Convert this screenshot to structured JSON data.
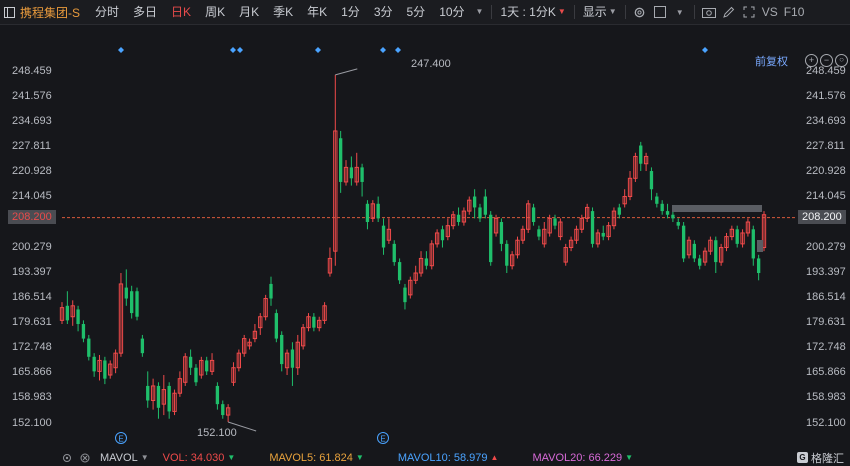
{
  "toolbar": {
    "title": "携程集团-S",
    "periods": [
      "分时",
      "多日",
      "日K",
      "周K",
      "月K",
      "季K",
      "年K",
      "1分",
      "3分",
      "5分",
      "10分"
    ],
    "active_period": "日K",
    "range_select": "1天 : 1分K",
    "display_label": "显示",
    "vs_label": "VS",
    "f10_label": "F10"
  },
  "chart": {
    "adjust_label": "前复权",
    "price_axis": [
      "248.459",
      "241.576",
      "234.693",
      "227.811",
      "220.928",
      "214.045",
      "208.200",
      "200.279",
      "193.397",
      "186.514",
      "179.631",
      "172.748",
      "165.866",
      "158.983",
      "152.100"
    ],
    "current_price": "208.200",
    "high_annotation": "247.400",
    "low_annotation": "152.100",
    "event_marker": "E",
    "colors": {
      "up": "#f04a4a",
      "down": "#1fbf6b",
      "background": "#16171b",
      "price_line": "#d85a3a",
      "diamond": "#4aa3ff"
    }
  },
  "chart_data": {
    "type": "candlestick",
    "ylim": [
      148.5,
      251.5
    ],
    "y_ticks": [
      248.459,
      241.576,
      234.693,
      227.811,
      220.928,
      214.045,
      208.2,
      200.279,
      193.397,
      186.514,
      179.631,
      172.748,
      165.866,
      158.983,
      152.1
    ],
    "candles": [
      [
        180.0,
        183.5,
        179.0,
        185.0
      ],
      [
        184.0,
        180.0,
        179.0,
        188.0
      ],
      [
        181.0,
        184.0,
        178.5,
        185.5
      ],
      [
        183.0,
        179.0,
        177.0,
        184.0
      ],
      [
        179.0,
        175.0,
        174.0,
        180.0
      ],
      [
        175.0,
        170.0,
        169.0,
        176.0
      ],
      [
        170.0,
        166.0,
        164.5,
        171.0
      ],
      [
        166.0,
        169.0,
        163.5,
        170.5
      ],
      [
        169.0,
        164.0,
        162.5,
        170.0
      ],
      [
        165.0,
        168.0,
        164.0,
        169.0
      ],
      [
        167.0,
        171.0,
        165.5,
        172.0
      ],
      [
        171.0,
        190.0,
        170.0,
        193.0
      ],
      [
        189.0,
        186.0,
        184.0,
        194.0
      ],
      [
        188.0,
        182.0,
        180.5,
        189.5
      ],
      [
        188.0,
        181.0,
        180.0,
        189.0
      ],
      [
        175.0,
        171.0,
        170.0,
        176.0
      ],
      [
        162.0,
        158.0,
        156.0,
        166.0
      ],
      [
        158.0,
        162.0,
        155.5,
        164.0
      ],
      [
        162.0,
        156.0,
        153.0,
        163.0
      ],
      [
        157.0,
        161.0,
        154.0,
        165.0
      ],
      [
        162.0,
        155.0,
        153.0,
        163.0
      ],
      [
        155.0,
        160.0,
        154.0,
        161.0
      ],
      [
        160.0,
        164.0,
        159.0,
        166.0
      ],
      [
        163.0,
        170.0,
        162.0,
        171.0
      ],
      [
        170.0,
        167.0,
        165.0,
        172.0
      ],
      [
        167.0,
        163.0,
        162.0,
        168.0
      ],
      [
        165.0,
        169.0,
        164.0,
        170.0
      ],
      [
        169.0,
        166.0,
        165.0,
        170.0
      ],
      [
        166.0,
        169.0,
        165.0,
        171.0
      ],
      [
        162.0,
        157.0,
        155.5,
        163.0
      ],
      [
        157.0,
        154.0,
        153.0,
        158.0
      ],
      [
        154.0,
        156.0,
        152.1,
        157.0
      ],
      [
        163.0,
        167.0,
        162.0,
        168.5
      ],
      [
        167.0,
        171.0,
        166.0,
        172.0
      ],
      [
        171.0,
        175.0,
        170.0,
        176.0
      ],
      [
        173.0,
        174.0,
        172.0,
        175.0
      ],
      [
        175.0,
        177.0,
        174.0,
        179.0
      ],
      [
        178.0,
        181.0,
        176.0,
        182.0
      ],
      [
        181.0,
        186.0,
        180.0,
        187.0
      ],
      [
        190.0,
        186.0,
        184.0,
        192.0
      ],
      [
        182.0,
        175.0,
        174.0,
        183.0
      ],
      [
        176.0,
        168.0,
        166.0,
        177.0
      ],
      [
        167.0,
        171.0,
        165.0,
        172.0
      ],
      [
        172.0,
        167.0,
        162.0,
        174.0
      ],
      [
        167.0,
        174.0,
        165.0,
        176.0
      ],
      [
        173.0,
        178.0,
        172.0,
        179.0
      ],
      [
        178.0,
        181.0,
        177.0,
        182.0
      ],
      [
        181.0,
        178.0,
        177.0,
        182.0
      ],
      [
        178.0,
        180.0,
        177.0,
        181.0
      ],
      [
        180.0,
        184.0,
        179.0,
        185.0
      ],
      [
        193.0,
        197.0,
        192.0,
        200.0
      ],
      [
        199.0,
        232.0,
        195.0,
        247.4
      ],
      [
        230.0,
        218.0,
        215.0,
        232.0
      ],
      [
        218.0,
        222.0,
        217.0,
        224.0
      ],
      [
        222.0,
        219.0,
        217.0,
        225.0
      ],
      [
        218.0,
        222.0,
        217.0,
        226.0
      ],
      [
        222.0,
        218.0,
        214.0,
        223.0
      ],
      [
        212.0,
        207.0,
        205.0,
        213.0
      ],
      [
        208.0,
        212.0,
        207.0,
        213.0
      ],
      [
        212.0,
        208.0,
        207.0,
        214.0
      ],
      [
        206.0,
        200.0,
        198.0,
        208.0
      ],
      [
        202.0,
        205.0,
        201.0,
        208.0
      ],
      [
        201.0,
        196.0,
        195.0,
        202.0
      ],
      [
        196.0,
        191.0,
        190.0,
        197.0
      ],
      [
        189.0,
        185.0,
        183.0,
        190.0
      ],
      [
        187.0,
        191.0,
        186.0,
        192.0
      ],
      [
        191.0,
        193.0,
        190.0,
        195.0
      ],
      [
        193.0,
        197.0,
        192.0,
        199.0
      ],
      [
        197.0,
        195.0,
        194.0,
        199.0
      ],
      [
        195.0,
        201.0,
        194.0,
        202.0
      ],
      [
        201.0,
        204.0,
        200.0,
        205.0
      ],
      [
        205.0,
        202.0,
        200.0,
        206.0
      ],
      [
        203.0,
        206.0,
        202.0,
        208.0
      ],
      [
        206.0,
        209.0,
        205.0,
        210.0
      ],
      [
        209.0,
        207.0,
        206.0,
        211.0
      ],
      [
        207.0,
        210.0,
        206.0,
        211.0
      ],
      [
        210.0,
        213.0,
        209.0,
        214.0
      ],
      [
        214.0,
        211.0,
        208.0,
        216.0
      ],
      [
        211.0,
        208.0,
        207.0,
        212.0
      ],
      [
        214.0,
        209.0,
        208.0,
        216.0
      ],
      [
        209.0,
        196.0,
        195.0,
        210.0
      ],
      [
        204.0,
        208.0,
        203.0,
        209.0
      ],
      [
        207.0,
        201.0,
        199.0,
        208.0
      ],
      [
        201.0,
        195.0,
        193.0,
        202.0
      ],
      [
        195.0,
        198.0,
        194.0,
        199.0
      ],
      [
        198.0,
        202.0,
        197.0,
        203.0
      ],
      [
        202.0,
        205.0,
        201.0,
        206.0
      ],
      [
        205.0,
        212.0,
        204.0,
        213.0
      ],
      [
        211.0,
        207.0,
        206.0,
        212.0
      ],
      [
        205.0,
        203.0,
        202.0,
        206.0
      ],
      [
        201.0,
        205.0,
        200.0,
        207.0
      ],
      [
        204.0,
        208.0,
        203.0,
        209.0
      ],
      [
        208.0,
        206.0,
        205.0,
        209.0
      ],
      [
        203.0,
        207.0,
        202.0,
        208.0
      ],
      [
        196.0,
        200.0,
        195.0,
        201.0
      ],
      [
        200.0,
        202.0,
        199.0,
        203.0
      ],
      [
        202.0,
        205.0,
        201.0,
        206.0
      ],
      [
        205.0,
        208.0,
        204.0,
        209.0
      ],
      [
        208.0,
        211.0,
        207.0,
        212.0
      ],
      [
        210.0,
        201.0,
        200.0,
        211.0
      ],
      [
        201.0,
        204.0,
        200.0,
        205.0
      ],
      [
        204.0,
        203.0,
        202.0,
        206.0
      ],
      [
        203.0,
        206.0,
        202.0,
        207.0
      ],
      [
        206.0,
        210.0,
        205.0,
        211.0
      ],
      [
        211.0,
        209.0,
        208.0,
        212.0
      ],
      [
        212.0,
        214.0,
        211.0,
        216.0
      ],
      [
        214.0,
        219.0,
        213.0,
        221.0
      ],
      [
        219.0,
        225.0,
        218.0,
        226.0
      ],
      [
        228.0,
        223.0,
        221.0,
        229.0
      ],
      [
        223.0,
        225.0,
        221.0,
        226.0
      ],
      [
        221.0,
        216.0,
        213.0,
        222.0
      ],
      [
        214.0,
        212.0,
        211.0,
        215.0
      ],
      [
        212.0,
        210.0,
        209.0,
        213.0
      ],
      [
        210.0,
        209.0,
        208.0,
        212.0
      ],
      [
        209.0,
        208.0,
        207.0,
        210.0
      ],
      [
        207.0,
        206.0,
        205.0,
        208.0
      ],
      [
        206.0,
        197.0,
        196.0,
        207.0
      ],
      [
        198.0,
        202.0,
        197.0,
        203.0
      ],
      [
        201.0,
        197.0,
        196.0,
        202.0
      ],
      [
        197.0,
        195.0,
        194.0,
        198.0
      ],
      [
        196.0,
        199.0,
        195.0,
        200.0
      ],
      [
        199.0,
        202.0,
        198.0,
        203.0
      ],
      [
        202.0,
        196.0,
        193.0,
        203.0
      ],
      [
        196.0,
        200.0,
        195.0,
        201.0
      ],
      [
        200.0,
        203.0,
        199.0,
        204.0
      ],
      [
        203.0,
        205.0,
        202.0,
        206.0
      ],
      [
        205.0,
        201.0,
        200.0,
        206.0
      ],
      [
        201.0,
        204.0,
        200.0,
        205.0
      ],
      [
        204.0,
        207.0,
        203.0,
        208.0
      ],
      [
        205.0,
        197.0,
        195.0,
        206.0
      ],
      [
        197.0,
        193.0,
        191.0,
        198.0
      ],
      [
        200.0,
        209.0,
        199.0,
        210.0
      ]
    ]
  },
  "bottom_bar": {
    "mavol_label": "MAVOL",
    "vol_label": "VOL: 34.030",
    "mavol5_label": "MAVOL5: 61.824",
    "mavol10_label": "MAVOL10: 58.979",
    "mavol20_label": "MAVOL20: 66.229",
    "vol_color": "#f04a4a",
    "mavol5_color": "#e8a23c",
    "mavol10_color": "#4aa3ff",
    "mavol20_color": "#d86ad8",
    "brand": "格隆汇"
  }
}
